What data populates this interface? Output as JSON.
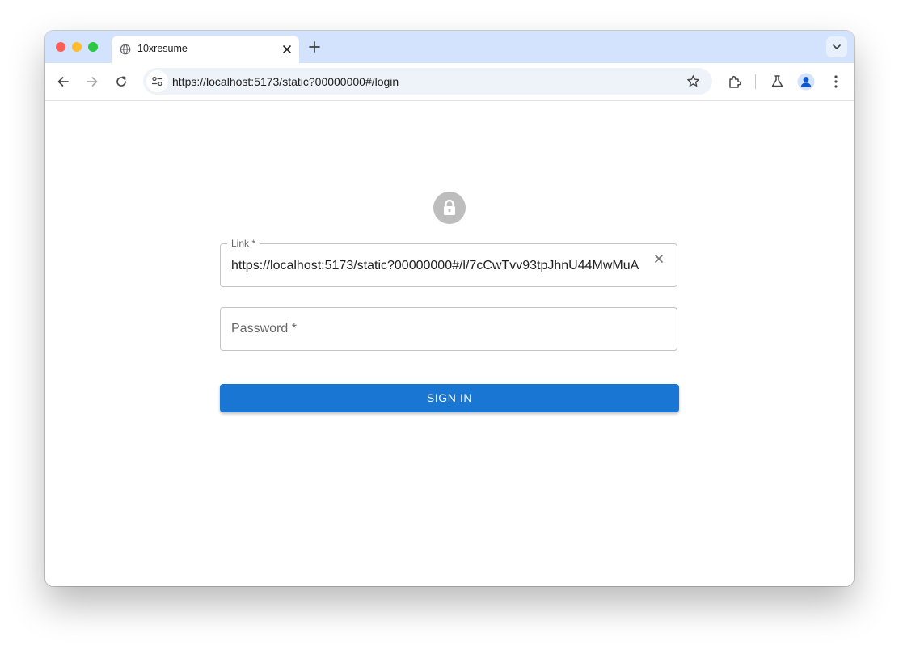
{
  "browser": {
    "tab": {
      "title": "10xresume",
      "icon": "globe-icon"
    },
    "address_bar": {
      "url": "https://localhost:5173/static?00000000#/login"
    },
    "icons": [
      "back-arrow-icon",
      "forward-arrow-icon",
      "reload-icon",
      "site-info-icon",
      "star-icon",
      "extensions-icon",
      "labs-flask-icon",
      "profile-avatar-icon",
      "more-menu-icon",
      "tab-search-icon",
      "new-tab-icon",
      "close-icon"
    ]
  },
  "login": {
    "icon": "lock-icon",
    "link_field": {
      "label": "Link",
      "required_mark": "*",
      "value": "https://localhost:5173/static?00000000#/l/7cCwTvv93tpJhnU44MwMuA"
    },
    "password_field": {
      "label": "Password",
      "required_mark": "*",
      "value": ""
    },
    "submit_label": "SIGN IN"
  },
  "colors": {
    "primary": "#1976d2",
    "avatar_bg": "#bdbdbd",
    "tabstrip": "#d3e3fd"
  }
}
